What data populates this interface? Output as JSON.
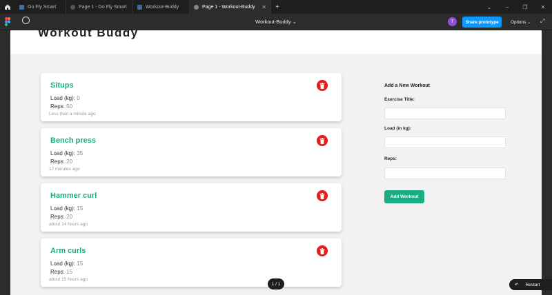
{
  "tabs": [
    {
      "label": "Go Fly Smart",
      "color": "#3a6ea5"
    },
    {
      "label": "Page 1 - Go Fly Smart",
      "color": "#555555"
    },
    {
      "label": "Workout-Buddy",
      "color": "#3a6ea5"
    },
    {
      "label": "Page 1 - Workout-Buddy",
      "color": "#888888"
    }
  ],
  "toolbar": {
    "file_name": "Workout-Buddy",
    "avatar_initial": "T",
    "share_label": "Share prototype",
    "options_label": "Options"
  },
  "app": {
    "brand": "Workout Buddy",
    "accent": "#1aac83",
    "delete_color": "#e61b1b",
    "load_label": "Load (kg):",
    "reps_label": "Reps:",
    "workouts": [
      {
        "title": "Situps",
        "load": "0",
        "reps": "50",
        "time": "Less than a minute ago"
      },
      {
        "title": "Bench press",
        "load": "35",
        "reps": "20",
        "time": "17 minutes ago"
      },
      {
        "title": "Hammer curl",
        "load": "15",
        "reps": "20",
        "time": "about 14 hours ago"
      },
      {
        "title": "Arm curls",
        "load": "15",
        "reps": "15",
        "time": "about 15 hours ago"
      }
    ],
    "form": {
      "heading": "Add a New Workout",
      "title_label": "Exercise Title:",
      "load_label": "Load (in kg):",
      "reps_label": "Reps:",
      "submit_label": "Add Workout"
    }
  },
  "prototype": {
    "page_indicator": "1 / 1",
    "restart_label": "Restart"
  }
}
